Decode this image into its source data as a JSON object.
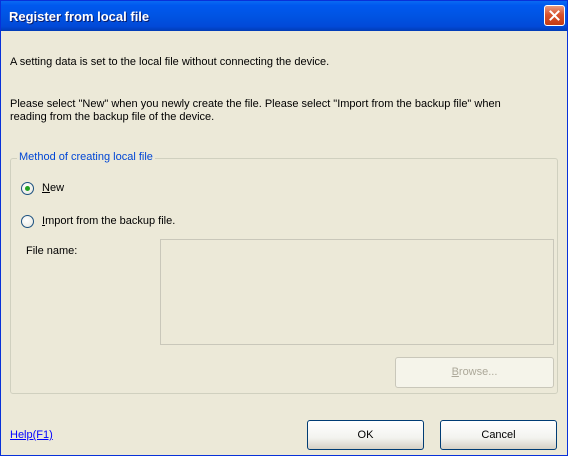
{
  "window": {
    "title": "Register from local file"
  },
  "intro": {
    "line1": "A setting data is set to the local file without connecting the device.",
    "line2": "Please select \"New\" when you newly create the file. Please select \"Import from the backup file\" when",
    "line3": "reading from the backup file of the device."
  },
  "group": {
    "legend": "Method of creating local file",
    "options": [
      {
        "mnemonic": "N",
        "rest": "ew",
        "selected": true
      },
      {
        "mnemonic": "I",
        "rest": "mport from the backup file.",
        "selected": false
      }
    ],
    "file_name_label": "File name:",
    "file_name_value": "",
    "browse": {
      "mnemonic": "B",
      "rest": "rowse...",
      "enabled": false
    }
  },
  "footer": {
    "help_label": "Help(F1)",
    "ok_label": "OK",
    "cancel_label": "Cancel"
  },
  "colors": {
    "title_bar": "#0054e3",
    "close_button": "#d9532e",
    "legend_text": "#0046d5",
    "radio_dot": "#21a121",
    "link": "#0000ff"
  },
  "icons": {
    "close": "close-icon"
  }
}
